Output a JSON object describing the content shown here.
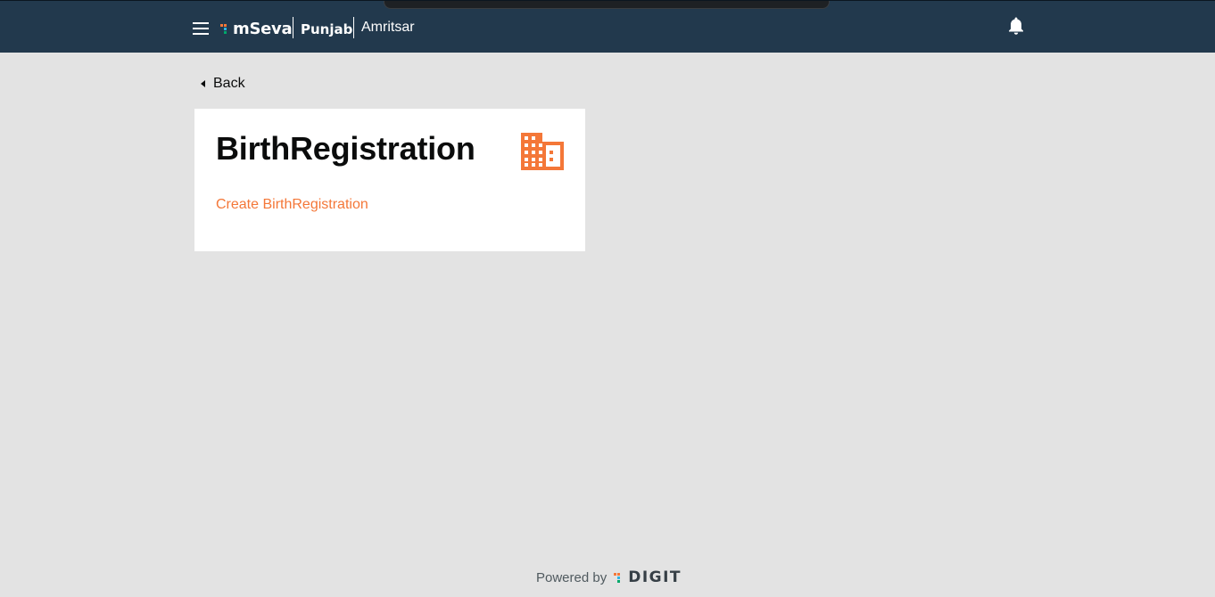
{
  "header": {
    "logo_text": "mSeva",
    "state": "Punjab",
    "city": "Amritsar",
    "menu_icon": "hamburger-menu-icon",
    "notification_icon": "bell-icon",
    "background_color": "#22394d"
  },
  "nav": {
    "back_label": "Back"
  },
  "card": {
    "title": "BirthRegistration",
    "icon": "building-icon",
    "icon_color": "#f47738",
    "links": [
      "Create BirthRegistration"
    ],
    "link_color": "#f47738"
  },
  "footer": {
    "powered_by": "Powered by",
    "brand": "DIGIT"
  }
}
